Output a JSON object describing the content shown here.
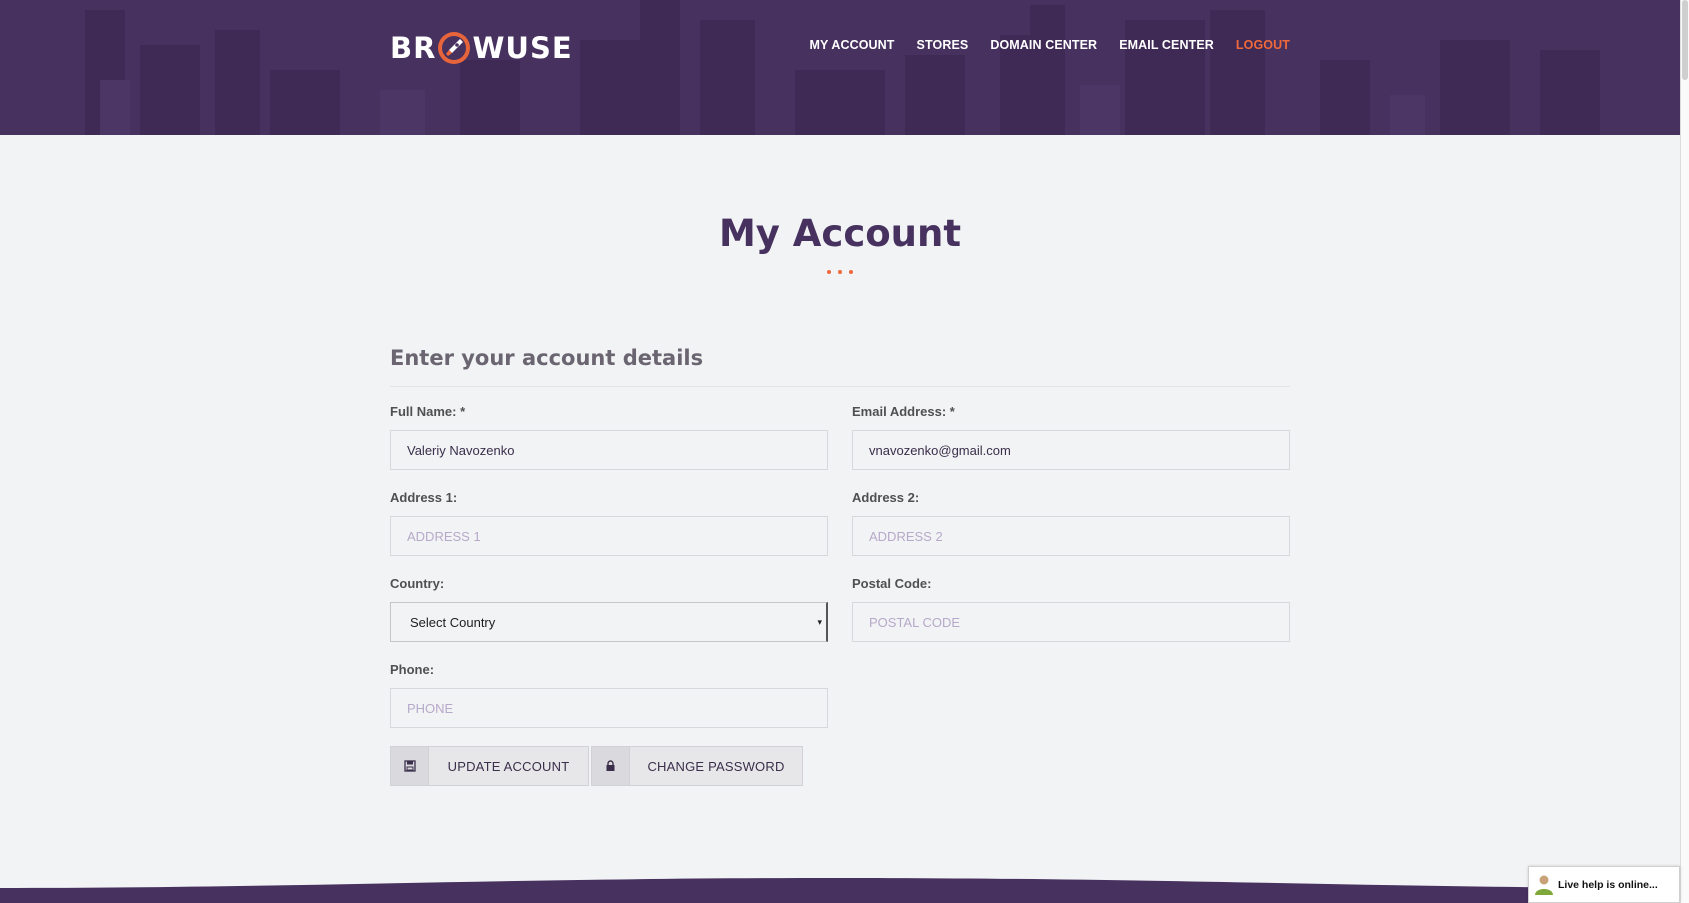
{
  "brand": {
    "logo_left": "BR",
    "logo_right": "WUSE"
  },
  "nav": {
    "items": [
      {
        "label": "MY ACCOUNT"
      },
      {
        "label": "STORES"
      },
      {
        "label": "DOMAIN CENTER"
      },
      {
        "label": "EMAIL CENTER"
      },
      {
        "label": "LOGOUT"
      }
    ]
  },
  "page": {
    "title": "My Account"
  },
  "form": {
    "section_title": "Enter your account details",
    "full_name": {
      "label": "Full Name: *",
      "value": "Valeriy Navozenko"
    },
    "email": {
      "label": "Email Address: *",
      "value": "vnavozenko@gmail.com"
    },
    "address1": {
      "label": "Address 1:",
      "placeholder": "ADDRESS 1"
    },
    "address2": {
      "label": "Address 2:",
      "placeholder": "ADDRESS 2"
    },
    "country": {
      "label": "Country:",
      "selected": "Select Country"
    },
    "postal_code": {
      "label": "Postal Code:",
      "placeholder": "POSTAL CODE"
    },
    "phone": {
      "label": "Phone:",
      "placeholder": "PHONE"
    },
    "update_button": "UPDATE ACCOUNT",
    "change_password_button": "CHANGE PASSWORD"
  },
  "live_help": {
    "text": "Live help is online..."
  },
  "colors": {
    "header_bg": "#47315f",
    "accent": "#f1693a",
    "title": "#47315f",
    "page_bg": "#f2f3f5"
  },
  "icons": [
    "rocket-icon",
    "save-icon",
    "lock-icon",
    "chevron-down-icon",
    "user-icon"
  ]
}
